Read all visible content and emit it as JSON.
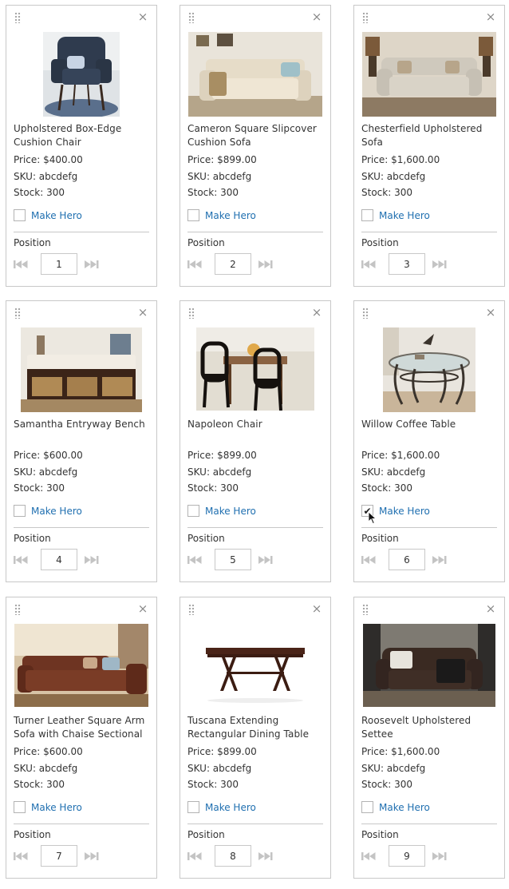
{
  "colors": {
    "link": "#1f6fb0",
    "border": "#c8c8c8",
    "text": "#333333"
  },
  "icons": {
    "drag": "drag-handle-icon",
    "close": "close-icon",
    "first": "skip-to-first-icon",
    "last": "skip-to-last-icon"
  },
  "products": [
    {
      "title": "Upholstered Box-Edge Cushion Chair",
      "price": "Price: $400.00",
      "sku": "SKU: abcdefg",
      "stock": "Stock: 300",
      "hero_label": "Make Hero",
      "hero_checked": false,
      "position_label": "Position",
      "position": "1",
      "close": "×"
    },
    {
      "title": "Cameron Square Slipcover Cushion Sofa",
      "price": "Price: $899.00",
      "sku": "SKU: abcdefg",
      "stock": "Stock: 300",
      "hero_label": "Make Hero",
      "hero_checked": false,
      "position_label": "Position",
      "position": "2",
      "close": "×"
    },
    {
      "title": "Chesterfield Upholstered Sofa",
      "price": "Price: $1,600.00",
      "sku": "SKU: abcdefg",
      "stock": "Stock: 300",
      "hero_label": "Make Hero",
      "hero_checked": false,
      "position_label": "Position",
      "position": "3",
      "close": "×"
    },
    {
      "title": "Samantha Entryway Bench",
      "price": "Price: $600.00",
      "sku": "SKU: abcdefg",
      "stock": "Stock: 300",
      "hero_label": "Make Hero",
      "hero_checked": false,
      "position_label": "Position",
      "position": "4",
      "close": "×"
    },
    {
      "title": "Napoleon Chair",
      "price": "Price: $899.00",
      "sku": "SKU: abcdefg",
      "stock": "Stock: 300",
      "hero_label": "Make Hero",
      "hero_checked": false,
      "position_label": "Position",
      "position": "5",
      "close": "×"
    },
    {
      "title": "Willow Coffee Table",
      "price": "Price: $1,600.00",
      "sku": "SKU: abcdefg",
      "stock": "Stock: 300",
      "hero_label": "Make Hero",
      "hero_checked": true,
      "position_label": "Position",
      "position": "6",
      "close": "×"
    },
    {
      "title": "Turner Leather Square Arm Sofa with Chaise Sectional",
      "price": "Price: $600.00",
      "sku": "SKU: abcdefg",
      "stock": "Stock: 300",
      "hero_label": "Make Hero",
      "hero_checked": false,
      "position_label": "Position",
      "position": "7",
      "close": "×"
    },
    {
      "title": "Tuscana Extending Rectangular Dining Table",
      "price": "Price: $899.00",
      "sku": "SKU: abcdefg",
      "stock": "Stock: 300",
      "hero_label": "Make Hero",
      "hero_checked": false,
      "position_label": "Position",
      "position": "8",
      "close": "×"
    },
    {
      "title": "Roosevelt Upholstered Settee",
      "price": "Price: $1,600.00",
      "sku": "SKU: abcdefg",
      "stock": "Stock: 300",
      "hero_label": "Make Hero",
      "hero_checked": false,
      "position_label": "Position",
      "position": "9",
      "close": "×"
    }
  ]
}
